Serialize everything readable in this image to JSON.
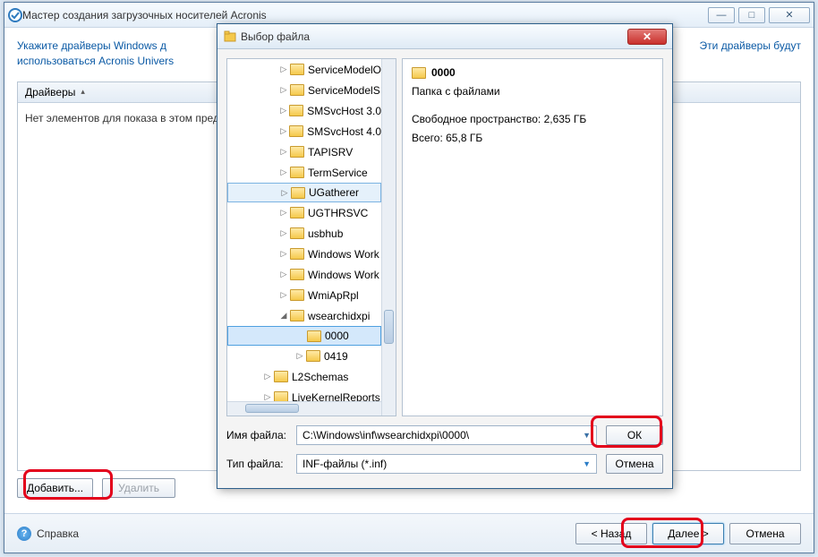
{
  "main": {
    "title": "Мастер создания загрузочных носителей Acronis",
    "instruction_prefix": "Укажите драйверы Windows д",
    "instruction_suffix": "Эти драйверы будут",
    "instruction_line2": "использоваться Acronis Univers",
    "drivers_header": "Драйверы",
    "empty_text": "Нет элементов для показа в этом пред",
    "add_btn": "Добавить...",
    "remove_btn": "Удалить",
    "help": "Справка",
    "back": "< Назад",
    "next": "Далее >",
    "cancel": "Отмена"
  },
  "dialog": {
    "title": "Выбор файла",
    "info": {
      "folder_name": "0000",
      "desc": "Папка с файлами",
      "free": "Свободное пространство: 2,635 ГБ",
      "total": "Всего: 65,8 ГБ"
    },
    "tree": [
      {
        "label": "ServiceModelO",
        "depth": 3,
        "exp": "▷"
      },
      {
        "label": "ServiceModelS",
        "depth": 3,
        "exp": "▷"
      },
      {
        "label": "SMSvcHost 3.0",
        "depth": 3,
        "exp": "▷"
      },
      {
        "label": "SMSvcHost 4.0",
        "depth": 3,
        "exp": "▷"
      },
      {
        "label": "TAPISRV",
        "depth": 3,
        "exp": "▷"
      },
      {
        "label": "TermService",
        "depth": 3,
        "exp": "▷"
      },
      {
        "label": "UGatherer",
        "depth": 3,
        "exp": "▷",
        "selected": true
      },
      {
        "label": "UGTHRSVC",
        "depth": 3,
        "exp": "▷"
      },
      {
        "label": "usbhub",
        "depth": 3,
        "exp": "▷"
      },
      {
        "label": "Windows Work",
        "depth": 3,
        "exp": "▷"
      },
      {
        "label": "Windows Work",
        "depth": 3,
        "exp": "▷"
      },
      {
        "label": "WmiApRpl",
        "depth": 3,
        "exp": "▷"
      },
      {
        "label": "wsearchidxpi",
        "depth": 3,
        "exp": "◢"
      },
      {
        "label": "0000",
        "depth": 4,
        "exp": "",
        "current": true
      },
      {
        "label": "0419",
        "depth": 4,
        "exp": "▷"
      },
      {
        "label": "L2Schemas",
        "depth": 2,
        "exp": "▷"
      },
      {
        "label": "LiveKernelReports",
        "depth": 2,
        "exp": "▷"
      }
    ],
    "filename_label": "Имя файла:",
    "filename_value": "C:\\Windows\\inf\\wsearchidxpi\\0000\\",
    "filetype_label": "Тип файла:",
    "filetype_value": "INF-файлы (*.inf)",
    "ok": "ОК",
    "cancel": "Отмена"
  }
}
